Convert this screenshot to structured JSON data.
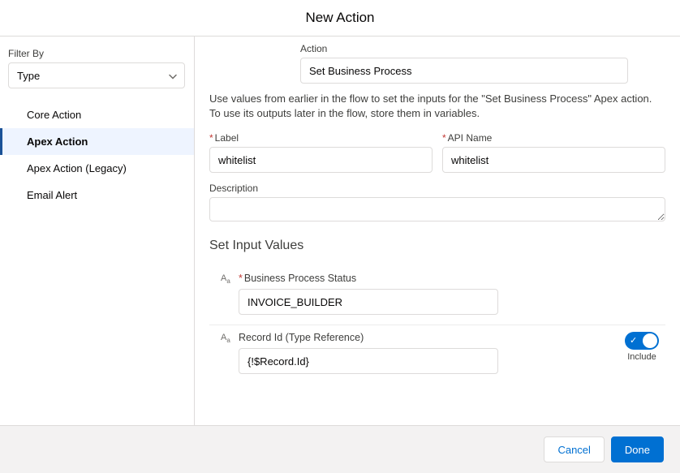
{
  "header": {
    "title": "New Action"
  },
  "sidebar": {
    "filter_label": "Filter By",
    "filter_value": "Type",
    "items": [
      {
        "label": "Core Action",
        "active": false
      },
      {
        "label": "Apex Action",
        "active": true
      },
      {
        "label": "Apex Action (Legacy)",
        "active": false
      },
      {
        "label": "Email Alert",
        "active": false
      }
    ]
  },
  "main": {
    "action_label": "Action",
    "action_value": "Set Business Process",
    "hint": "Use values from earlier in the flow to set the inputs for the \"Set Business Process\" Apex action. To use its outputs later in the flow, store them in variables.",
    "label_field": {
      "label": "Label",
      "value": "whitelist"
    },
    "api_name_field": {
      "label": "API Name",
      "value": "whitelist"
    },
    "description_field": {
      "label": "Description",
      "value": ""
    },
    "section_title": "Set Input Values",
    "inputs": [
      {
        "required": true,
        "label": "Business Process Status",
        "value": "INVOICE_BUILDER",
        "show_toggle": false
      },
      {
        "required": false,
        "label": "Record Id (Type Reference)",
        "value": "{!$Record.Id}",
        "show_toggle": true,
        "toggle_on": true,
        "toggle_label": "Include"
      }
    ]
  },
  "footer": {
    "cancel": "Cancel",
    "done": "Done"
  },
  "asterisk": "*"
}
